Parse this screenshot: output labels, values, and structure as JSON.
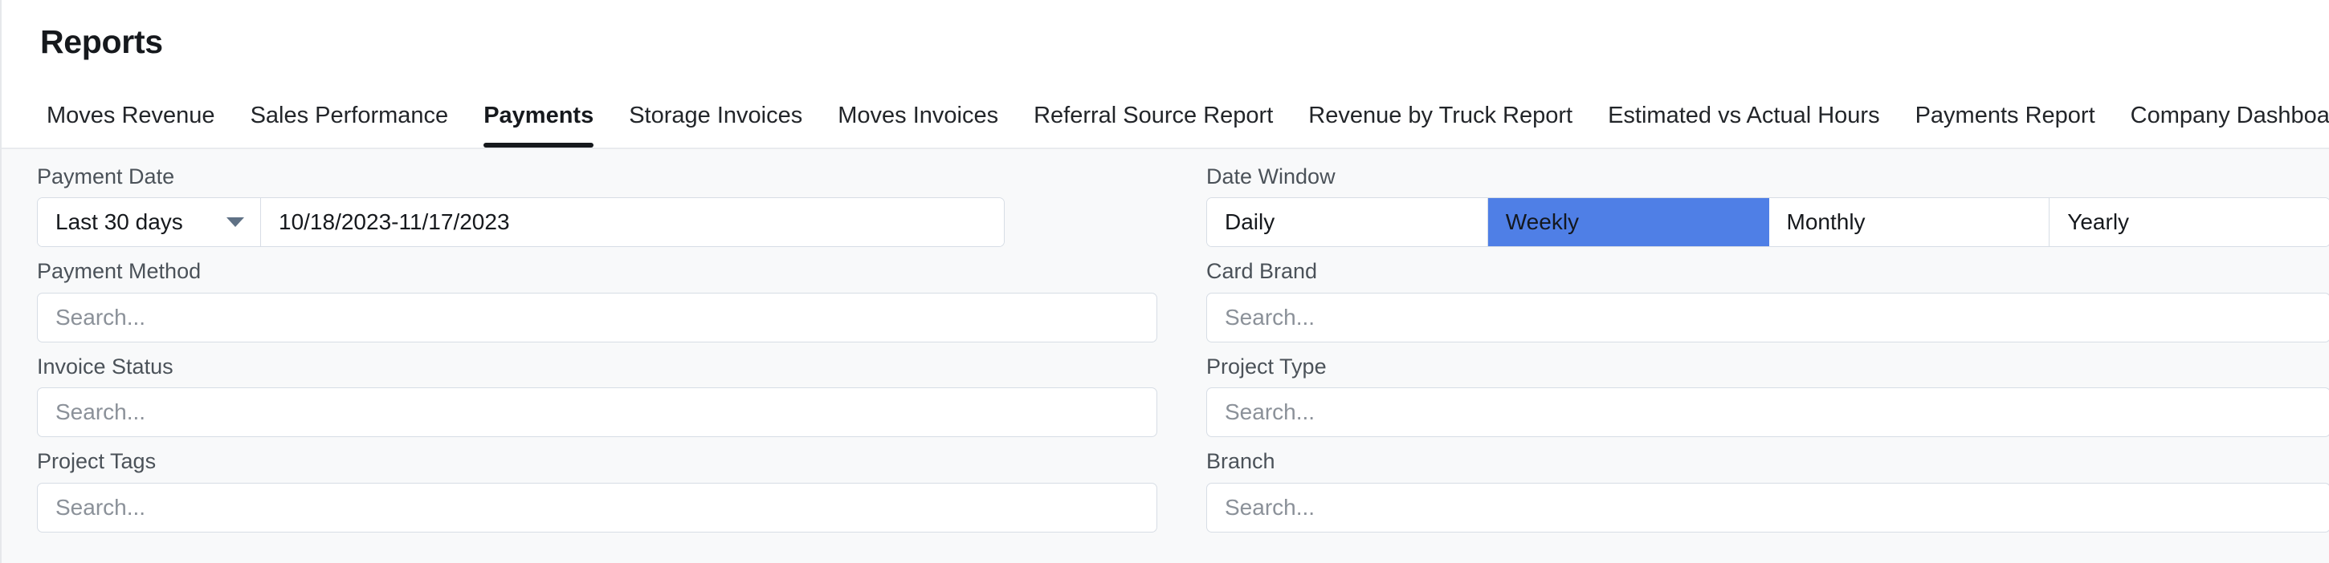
{
  "header": {
    "title": "Reports"
  },
  "tabs": [
    {
      "label": "Moves Revenue",
      "active": false
    },
    {
      "label": "Sales Performance",
      "active": false
    },
    {
      "label": "Payments",
      "active": true
    },
    {
      "label": "Storage Invoices",
      "active": false
    },
    {
      "label": "Moves Invoices",
      "active": false
    },
    {
      "label": "Referral Source Report",
      "active": false
    },
    {
      "label": "Revenue by Truck Report",
      "active": false
    },
    {
      "label": "Estimated vs Actual Hours",
      "active": false
    },
    {
      "label": "Payments Report",
      "active": false
    },
    {
      "label": "Company Dashboard",
      "active": false
    }
  ],
  "filters": {
    "payment_date": {
      "label": "Payment Date",
      "preset": "Last 30 days",
      "range": "10/18/2023-11/17/2023",
      "caret_icon": "chevron-down-icon"
    },
    "date_window": {
      "label": "Date Window",
      "options": [
        "Daily",
        "Weekly",
        "Monthly",
        "Yearly"
      ],
      "selected": "Weekly",
      "selected_color": "#4f7fe6"
    },
    "payment_method": {
      "label": "Payment Method",
      "value": "",
      "placeholder": "Search..."
    },
    "card_brand": {
      "label": "Card Brand",
      "value": "",
      "placeholder": "Search..."
    },
    "invoice_status": {
      "label": "Invoice Status",
      "value": "",
      "placeholder": "Search..."
    },
    "project_type": {
      "label": "Project Type",
      "value": "",
      "placeholder": "Search..."
    },
    "project_tags": {
      "label": "Project Tags",
      "value": "",
      "placeholder": "Search..."
    },
    "branch": {
      "label": "Branch",
      "value": "",
      "placeholder": "Search..."
    }
  }
}
